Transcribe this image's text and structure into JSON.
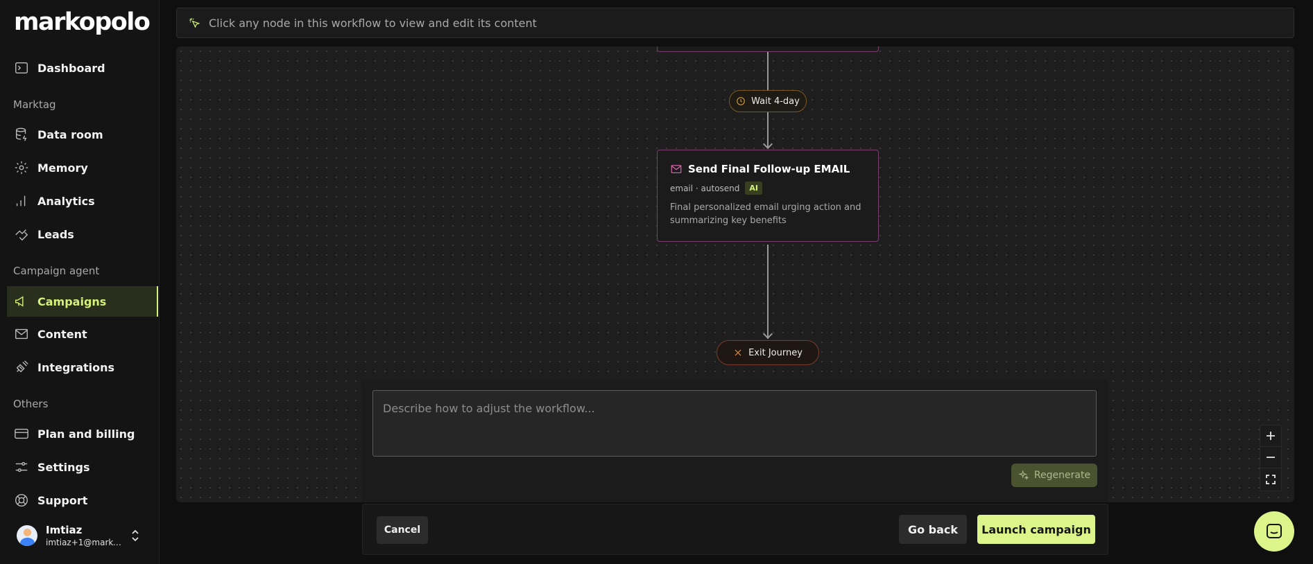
{
  "brand": {
    "logo_text": "markopolo"
  },
  "sidebar": {
    "items": [
      {
        "label": "Dashboard",
        "icon": "terminal-icon"
      },
      {
        "label": "Data room",
        "icon": "database-icon"
      },
      {
        "label": "Memory",
        "icon": "brain-gear-icon"
      },
      {
        "label": "Analytics",
        "icon": "bar-chart-icon"
      },
      {
        "label": "Leads",
        "icon": "handshake-icon"
      },
      {
        "label": "Campaigns",
        "icon": "megaphone-icon",
        "active": true
      },
      {
        "label": "Content",
        "icon": "mail-icon"
      },
      {
        "label": "Integrations",
        "icon": "plug-icon"
      },
      {
        "label": "Plan and billing",
        "icon": "credit-card-icon"
      },
      {
        "label": "Settings",
        "icon": "sliders-icon"
      },
      {
        "label": "Support",
        "icon": "lifebuoy-icon"
      }
    ],
    "sections": {
      "marktag": "Marktag",
      "campaign_agent": "Campaign agent",
      "others": "Others"
    },
    "user": {
      "name": "Imtiaz",
      "email": "imtiaz+1@markopolo.ai"
    }
  },
  "hint": {
    "text": "Click any node in this workflow to view and edit its content"
  },
  "workflow": {
    "wait_node": {
      "label": "Wait 4-day"
    },
    "email_node": {
      "title": "Send Final Follow-up EMAIL",
      "meta": "email · autosend",
      "badge": "AI",
      "description": "Final personalized email urging action and summarizing key benefits"
    },
    "exit_node": {
      "label": "Exit Journey"
    }
  },
  "prompt": {
    "placeholder": "Describe how to adjust the workflow...",
    "regenerate_label": "Regenerate"
  },
  "footer": {
    "cancel_label": "Cancel",
    "go_back_label": "Go back",
    "launch_label": "Launch campaign"
  },
  "colors": {
    "accent": "#dcf58a",
    "email_border": "#7a3f6e",
    "wait_border": "#7a5a22",
    "exit_border": "#7a3c2a"
  }
}
